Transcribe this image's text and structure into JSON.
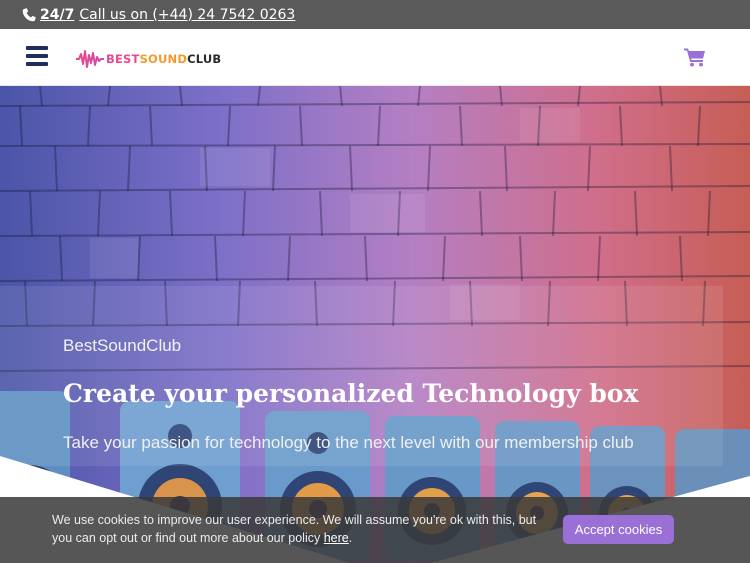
{
  "topbar": {
    "hours": "24/7",
    "call_text": "Call us on (+44) 24 7542 0263",
    "phone_icon": "phone-icon"
  },
  "header": {
    "menu_icon": "hamburger-menu-icon",
    "logo": {
      "part1": "BEST",
      "part2": "SOUND",
      "part3": "CLUB"
    },
    "cart_icon": "shopping-cart-icon"
  },
  "hero": {
    "eyebrow": "BestSoundClub",
    "title": "Create your personalized Technology box",
    "subtitle": "Take your passion for technology to the next level with our membership club"
  },
  "cookie": {
    "text": "We use cookies to improve our user experience. We will assume you're ok with this, but you can opt out or find out more about our policy",
    "link": "here",
    "suffix": ".",
    "accept_label": "Accept cookies"
  },
  "colors": {
    "topbar_bg": "#5a5a5a",
    "navy": "#202f5a",
    "accent_purple": "#9a6fd6",
    "logo_pink": "#e94a8c",
    "logo_orange": "#f39a2e"
  }
}
